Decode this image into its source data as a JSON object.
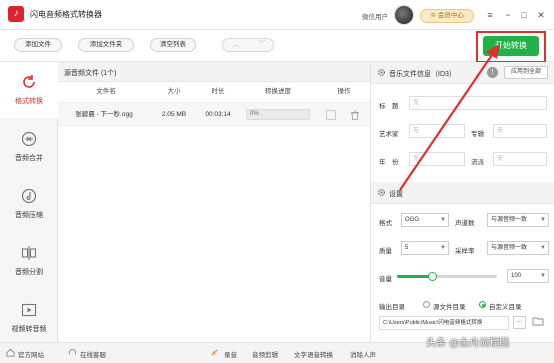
{
  "app": {
    "title": "闪电音频格式转换器",
    "user": "微信用户",
    "vip": "会员中心"
  },
  "window_controls": {
    "menu": "≡",
    "minimize": "−",
    "maximize": "□",
    "close": "✕"
  },
  "toolbar": {
    "add_file": "添加文件",
    "add_folder": "添加文件夹",
    "clear_list": "清空列表",
    "start": "开始转换"
  },
  "sidebar": {
    "items": [
      {
        "label": "格式转换",
        "icon": "convert-icon",
        "active": true
      },
      {
        "label": "音频合并",
        "icon": "merge-icon"
      },
      {
        "label": "音频压缩",
        "icon": "compress-icon"
      },
      {
        "label": "音频分割",
        "icon": "split-icon"
      },
      {
        "label": "视频转音频",
        "icon": "video-to-audio-icon"
      }
    ]
  },
  "file_list": {
    "header": "源音频文件 (1个)",
    "columns": [
      "文件名",
      "大小",
      "时长",
      "转换进度",
      "操作"
    ],
    "rows": [
      {
        "name": "张碧晨 - 下一秒.ogg",
        "size": "2.05 MB",
        "duration": "00:03:14",
        "progress": "0%"
      }
    ]
  },
  "info": {
    "title": "音乐文件信息（ID3）",
    "apply_all": "应用到全部",
    "fields": {
      "title_label": "标　题",
      "artist_label": "艺术家",
      "album_label": "专辑",
      "year_label": "年　份",
      "genre_label": "流派",
      "placeholder": "无"
    }
  },
  "settings": {
    "title": "设置",
    "format_label": "格式",
    "format_value": "OGG",
    "channel_label": "声道数",
    "channel_value": "与源音频一致",
    "quality_label": "质量",
    "quality_value": "5",
    "samplerate_label": "采样率",
    "samplerate_value": "与源音频一致",
    "volume_label": "音量",
    "volume_value": "100",
    "volume_fraction": 0.35,
    "output_label": "输出目录",
    "source_dir": "源文件目录",
    "custom_dir": "自定义目录",
    "path": "C:\\Users\\Public\\Music\\闪电音频格式转换"
  },
  "statusbar": {
    "website": "官方网站",
    "support": "在线客服",
    "record": "录音",
    "edit": "音频剪辑",
    "tts": "文字语音转换",
    "vocal": "消除人声"
  },
  "watermark": "头条 @金舟流程图",
  "colors": {
    "accent": "#21b14b",
    "brand": "#e0302c"
  }
}
